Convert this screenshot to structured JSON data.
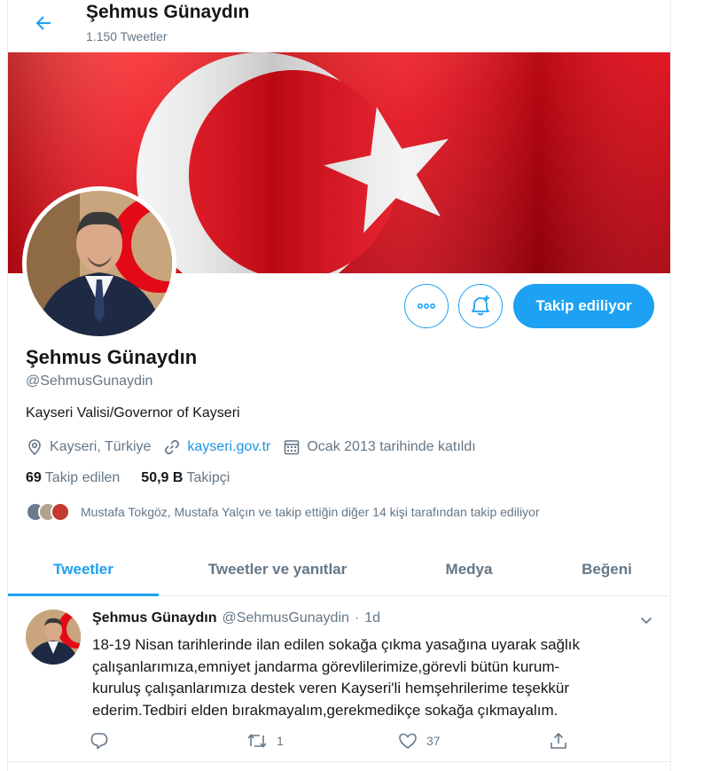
{
  "header": {
    "title": "Şehmus Günaydın",
    "subtitle": "1.150 Tweetler"
  },
  "profile": {
    "name": "Şehmus Günaydın",
    "handle": "@SehmusGunaydin",
    "bio": "Kayseri Valisi/Governor of Kayseri",
    "location": "Kayseri, Türkiye",
    "website": "kayseri.gov.tr",
    "joined": "Ocak 2013 tarihinde katıldı",
    "following_count": "69",
    "following_label": "Takip edilen",
    "followers_count": "50,9 B",
    "followers_label": "Takipçi",
    "followed_by": "Mustafa Tokgöz, Mustafa Yalçın ve takip ettiğin diğer 14 kişi tarafından takip ediliyor"
  },
  "actions": {
    "follow_label": "Takip ediliyor"
  },
  "tabs": [
    {
      "label": "Tweetler",
      "active": true
    },
    {
      "label": "Tweetler ve yanıtlar",
      "active": false
    },
    {
      "label": "Medya",
      "active": false
    },
    {
      "label": "Beğeni",
      "active": false
    }
  ],
  "tweet": {
    "name": "Şehmus Günaydın",
    "handle": "@SehmusGunaydin",
    "separator": "·",
    "time": "1d",
    "lines": [
      "18-19 Nisan tarihlerinde ilan edilen sokağa çıkma yasağına uyarak sağlık",
      "çalışanlarımıza,emniyet jandarma görevlilerimize,görevli bütün kurum-",
      "kuruluş çalışanlarımıza destek veren Kayseri'li hemşehrilerime teşekkür",
      "ederim.Tedbiri elden bırakmayalım,gerekmedikçe sokağa çıkmayalım."
    ],
    "reply_count": "",
    "retweet_count": "1",
    "like_count": "37"
  },
  "colors": {
    "accent": "#1da1f2",
    "link": "#1b95e0",
    "secondary_text": "#657786",
    "flag_red": "#e30a17"
  },
  "icons": [
    "back-arrow-icon",
    "more-icon",
    "bell-plus-icon",
    "location-icon",
    "link-icon",
    "calendar-icon",
    "reply-icon",
    "retweet-icon",
    "like-icon",
    "share-icon",
    "chevron-down-icon"
  ]
}
